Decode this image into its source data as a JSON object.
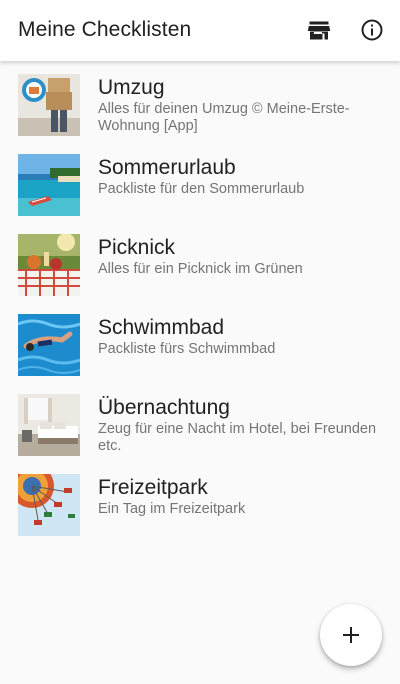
{
  "appbar": {
    "title": "Meine Checklisten",
    "actions": [
      {
        "icon": "store-icon"
      },
      {
        "icon": "info-icon"
      }
    ]
  },
  "checklists": [
    {
      "title": "Umzug",
      "subtitle": "Alles für deinen Umzug © Meine-Erste-Wohnung [App]",
      "thumbnail": "moving-boxes-photo"
    },
    {
      "title": "Sommerurlaub",
      "subtitle": "Packliste für den Sommerurlaub",
      "thumbnail": "beach-photo"
    },
    {
      "title": "Picknick",
      "subtitle": "Alles für ein Picknick im Grünen",
      "thumbnail": "picnic-photo"
    },
    {
      "title": "Schwimmbad",
      "subtitle": "Packliste fürs Schwimmbad",
      "thumbnail": "swimming-pool-photo"
    },
    {
      "title": "Übernachtung",
      "subtitle": "Zeug für eine Nacht im Hotel, bei Freunden etc.",
      "thumbnail": "hotel-room-photo"
    },
    {
      "title": "Freizeitpark",
      "subtitle": "Ein Tag im Freizeitpark",
      "thumbnail": "carousel-ride-photo"
    }
  ],
  "fab": {
    "icon": "plus-icon"
  }
}
